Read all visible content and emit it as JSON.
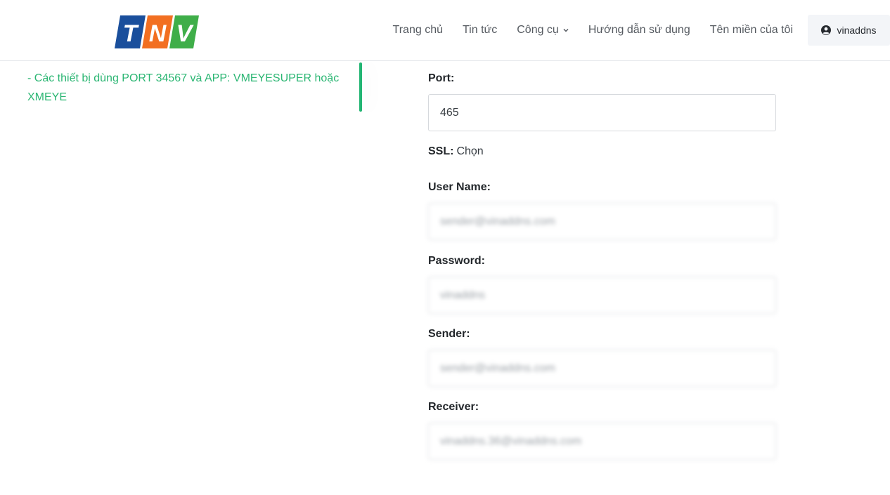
{
  "header": {
    "logo_text": "TNV",
    "logo_colors": [
      "#1a4f9c",
      "#f26f21",
      "#3fae49"
    ],
    "nav": [
      {
        "label": "Trang chủ"
      },
      {
        "label": "Tin tức"
      },
      {
        "label": "Công cụ",
        "has_dropdown": true
      },
      {
        "label": "Hướng dẫn sử dụng"
      },
      {
        "label": "Tên miền của tôi"
      }
    ],
    "user": {
      "label": "vinaddns",
      "icon": "user-circle-icon"
    }
  },
  "sidebar": {
    "link_text": "- Các thiết bị dùng PORT 34567 và APP: VMEYESUPER hoặc XMEYE",
    "accent_color": "#2bb673"
  },
  "form": {
    "port": {
      "label": "Port:",
      "value": "465"
    },
    "ssl": {
      "label": "SSL:",
      "value": "Chọn"
    },
    "username": {
      "label": "User Name:",
      "value": "sender@vinaddns.com"
    },
    "password": {
      "label": "Password:",
      "value": "vinaddns"
    },
    "sender": {
      "label": "Sender:",
      "value": "sender@vinaddns.com"
    },
    "receiver": {
      "label": "Receiver:",
      "value": "vinaddns.36@vinaddns.com"
    }
  }
}
